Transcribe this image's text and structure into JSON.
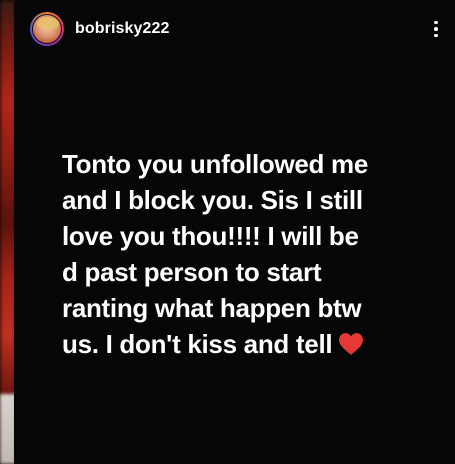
{
  "story": {
    "username": "bobrisky222",
    "message_lines": [
      "Tonto you unfollowed me",
      "and I block you. Sis I still",
      "love you thou!!!!  I will be",
      "d past person to start",
      "ranting what happen btw",
      "us. I don't kiss and tell"
    ],
    "accent_heart_color": "#e53935"
  }
}
